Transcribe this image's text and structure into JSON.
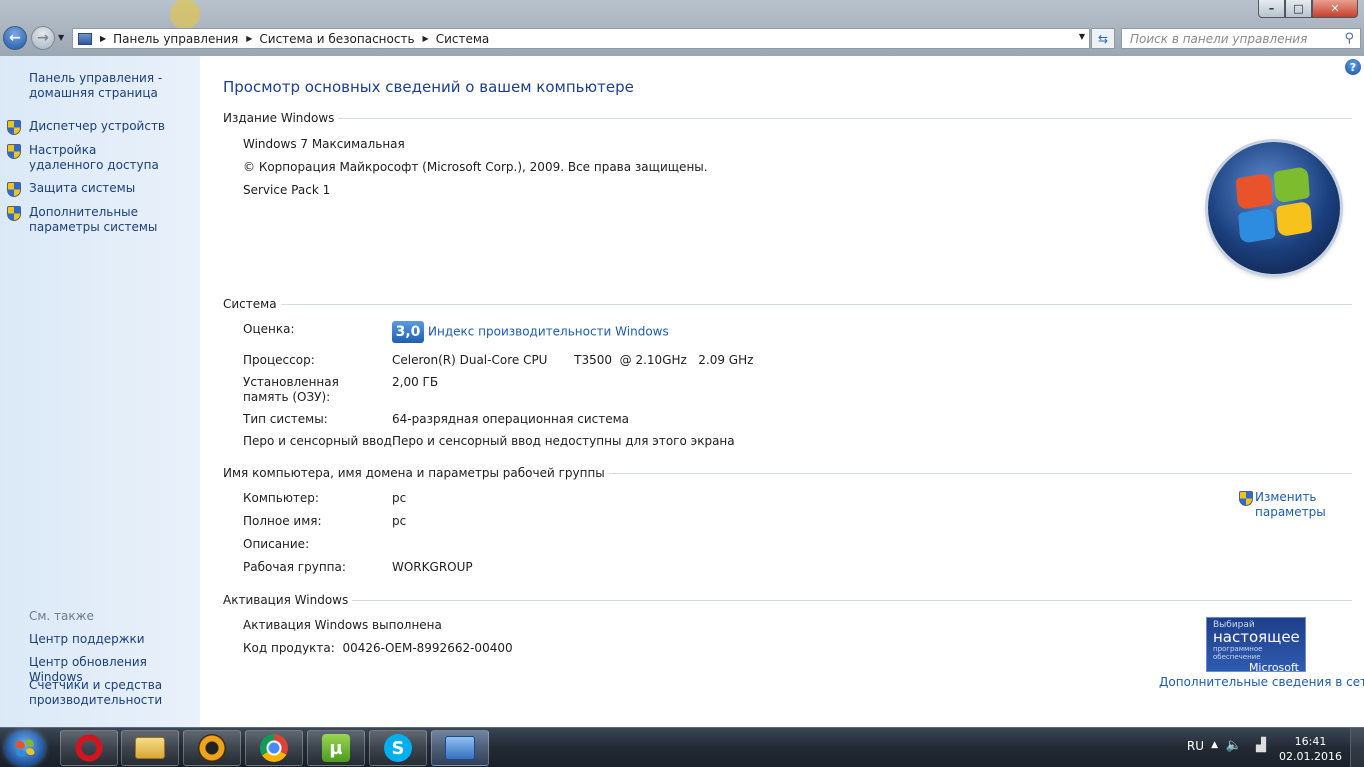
{
  "window": {
    "minimize": "–",
    "maximize": "□",
    "close": "✕"
  },
  "address": {
    "crumbs": [
      "Панель управления",
      "Система и безопасность",
      "Система"
    ],
    "search_placeholder": "Поиск в панели управления"
  },
  "left": {
    "home_link": "Панель управления - домашняя страница",
    "tasks": [
      "Диспетчер устройств",
      "Настройка удаленного доступа",
      "Защита системы",
      "Дополнительные параметры системы"
    ],
    "see_also_title": "См. также",
    "see_also": [
      "Центр поддержки",
      "Центр обновления Windows",
      "Счетчики и средства производительности"
    ]
  },
  "main": {
    "title": "Просмотр основных сведений о вашем компьютере",
    "edition": {
      "heading": "Издание Windows",
      "name": "Windows 7 Максимальная",
      "copyright": "© Корпорация Майкрософт (Microsoft Corp.), 2009. Все права защищены.",
      "service_pack": "Service Pack 1"
    },
    "system": {
      "heading": "Система",
      "rating_label": "Оценка:",
      "rating_score": "3,0",
      "rating_link": "Индекс производительности Windows",
      "cpu_label": "Процессор:",
      "cpu_value": "Celeron(R) Dual-Core CPU       T3500  @ 2.10GHz   2.09 GHz",
      "ram_label": "Установленная память (ОЗУ):",
      "ram_value": "2,00 ГБ",
      "type_label": "Тип системы:",
      "type_value": "64-разрядная операционная система",
      "pen_label": "Перо и сенсорный ввод:",
      "pen_value": "Перо и сенсорный ввод недоступны для этого экрана"
    },
    "computer": {
      "heading": "Имя компьютера, имя домена и параметры рабочей группы",
      "name_label": "Компьютер:",
      "name_value": "pc",
      "full_label": "Полное имя:",
      "full_value": "pc",
      "desc_label": "Описание:",
      "desc_value": "",
      "wg_label": "Рабочая группа:",
      "wg_value": "WORKGROUP",
      "change_link": "Изменить параметры"
    },
    "activation": {
      "heading": "Активация Windows",
      "status": "Активация Windows выполнена",
      "product_key": "Код продукта:  00426-OEM-8992662-00400",
      "more_link": "Дополнительные сведения в сети...",
      "genuine": {
        "line1": "Выбирай",
        "line2": "настоящее",
        "line3": "программное обеспечение",
        "line4": "Microsoft"
      }
    }
  },
  "taskbar": {
    "language": "RU",
    "time": "16:41",
    "date": "02.01.2016"
  }
}
